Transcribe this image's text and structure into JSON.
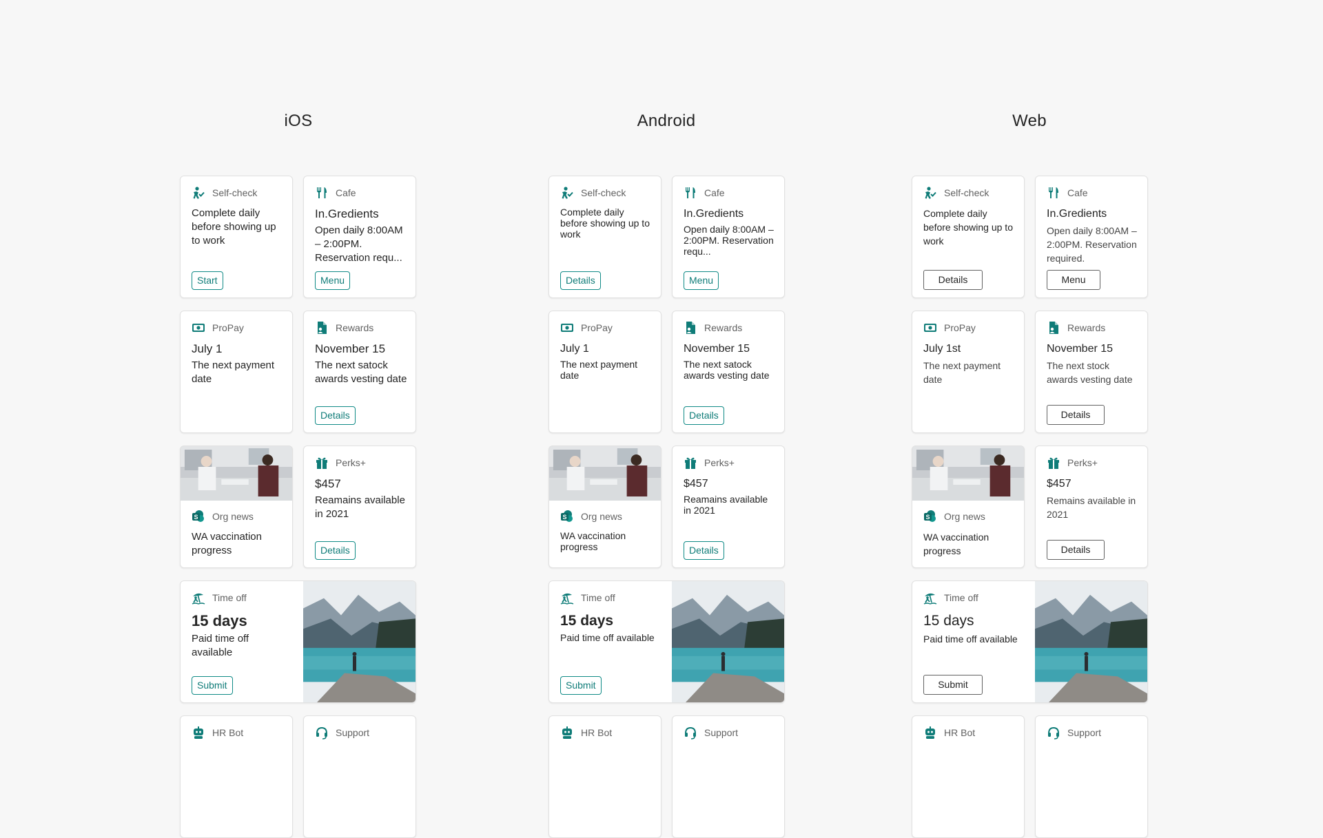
{
  "columns": [
    {
      "title": "iOS",
      "cards": {
        "selfcheck": {
          "category": "Self-check",
          "text": "Complete daily before showing up to work",
          "button": "Start"
        },
        "cafe": {
          "category": "Cafe",
          "title": "In.Gredients",
          "text": "Open daily 8:00AM – 2:00PM. Reservation requ...",
          "button": "Menu"
        },
        "propay": {
          "category": "ProPay",
          "title": "July 1",
          "text": "The next payment date"
        },
        "rewards": {
          "category": "Rewards",
          "title": "November 15",
          "text": "The next satock awards vesting date",
          "button": "Details"
        },
        "orgnews": {
          "category": "Org news",
          "text": "WA vaccination progress"
        },
        "perks": {
          "category": "Perks+",
          "title": "$457",
          "text": "Reamains available in 2021",
          "button": "Details"
        },
        "timeoff": {
          "category": "Time off",
          "title": "15 days",
          "text": "Paid time off available",
          "button": "Submit"
        },
        "hrbot": {
          "category": "HR Bot"
        },
        "support": {
          "category": "Support"
        }
      }
    },
    {
      "title": "Android",
      "cards": {
        "selfcheck": {
          "category": "Self-check",
          "text": "Complete daily before showing up to work",
          "button": "Details"
        },
        "cafe": {
          "category": "Cafe",
          "title": "In.Gredients",
          "text": "Open daily 8:00AM – 2:00PM. Reservation requ...",
          "button": "Menu"
        },
        "propay": {
          "category": "ProPay",
          "title": "July 1",
          "text": "The next payment date"
        },
        "rewards": {
          "category": "Rewards",
          "title": "November 15",
          "text": "The next satock awards vesting date",
          "button": "Details"
        },
        "orgnews": {
          "category": "Org news",
          "text": "WA vaccination progress"
        },
        "perks": {
          "category": "Perks+",
          "title": "$457",
          "text": "Reamains available in 2021",
          "button": "Details"
        },
        "timeoff": {
          "category": "Time off",
          "title": "15 days",
          "text": "Paid time off available",
          "button": "Submit"
        },
        "hrbot": {
          "category": "HR Bot"
        },
        "support": {
          "category": "Support"
        }
      }
    },
    {
      "title": "Web",
      "cards": {
        "selfcheck": {
          "category": "Self-check",
          "text": "Complete daily before showing up to work",
          "button": "Details"
        },
        "cafe": {
          "category": "Cafe",
          "title": "In.Gredients",
          "text": "Open daily 8:00AM – 2:00PM. Reservation required.",
          "button": "Menu"
        },
        "propay": {
          "category": "ProPay",
          "title": "July 1st",
          "text": "The next payment date"
        },
        "rewards": {
          "category": "Rewards",
          "title": "November 15",
          "text": "The next stock awards vesting date",
          "button": "Details"
        },
        "orgnews": {
          "category": "Org news",
          "text": "WA vaccination progress"
        },
        "perks": {
          "category": "Perks+",
          "title": "$457",
          "text": "Remains available in 2021",
          "button": "Details"
        },
        "timeoff": {
          "category": "Time off",
          "title": "15 days",
          "text": "Paid time off available",
          "button": "Submit"
        },
        "hrbot": {
          "category": "HR Bot"
        },
        "support": {
          "category": "Support"
        }
      }
    }
  ],
  "icons": {
    "selfcheck": "person-check-icon",
    "cafe": "fork-knife-icon",
    "propay": "money-icon",
    "rewards": "document-person-icon",
    "orgnews": "sharepoint-icon",
    "perks": "gift-icon",
    "timeoff": "beach-person-icon",
    "hrbot": "bot-icon",
    "support": "headset-icon"
  },
  "colors": {
    "accent": "#0f7c78",
    "background": "#f7f7f7",
    "card": "#ffffff"
  }
}
